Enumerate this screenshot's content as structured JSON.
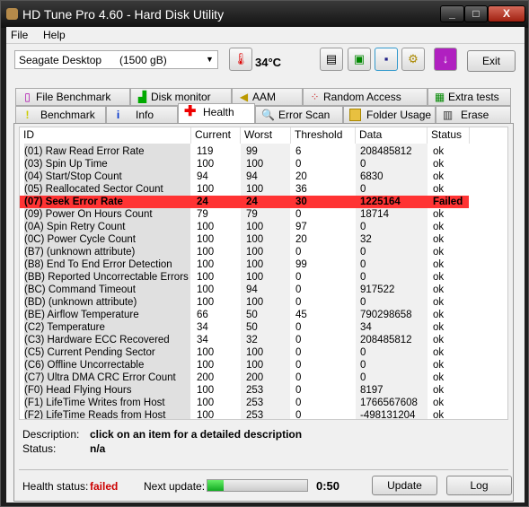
{
  "window": {
    "title": "HD Tune Pro 4.60 - Hard Disk Utility",
    "minimize": "_",
    "maximize": "□",
    "close": "X"
  },
  "menu": [
    "File",
    "Help"
  ],
  "toolbar": {
    "drive_name": "Seagate Desktop",
    "drive_size": "(1500 gB)",
    "temperature": "34°C",
    "exit_label": "Exit",
    "icons": [
      "copy-text-icon",
      "copy-screenshot-icon",
      "save-icon",
      "options-icon",
      "download-icon"
    ]
  },
  "tabs_top": [
    {
      "label": "File Benchmark",
      "icon": "file-benchmark-icon"
    },
    {
      "label": "Disk monitor",
      "icon": "disk-monitor-icon"
    },
    {
      "label": "AAM",
      "icon": "speaker-icon"
    },
    {
      "label": "Random Access",
      "icon": "random-access-icon"
    },
    {
      "label": "Extra tests",
      "icon": "extra-tests-icon"
    }
  ],
  "tabs_bottom": [
    {
      "label": "Benchmark",
      "icon": "exclamation-icon"
    },
    {
      "label": "Info",
      "icon": "info-icon"
    },
    {
      "label": "Health",
      "icon": "red-cross-icon",
      "active": true
    },
    {
      "label": "Error Scan",
      "icon": "magnifier-icon"
    },
    {
      "label": "Folder Usage",
      "icon": "folder-icon"
    },
    {
      "label": "Erase",
      "icon": "trash-icon"
    }
  ],
  "table": {
    "columns": [
      "ID",
      "Current",
      "Worst",
      "Threshold",
      "Data",
      "Status"
    ],
    "rows": [
      [
        "(01) Raw Read Error Rate",
        "119",
        "99",
        "6",
        "208485812",
        "ok"
      ],
      [
        "(03) Spin Up Time",
        "100",
        "100",
        "0",
        "0",
        "ok"
      ],
      [
        "(04) Start/Stop Count",
        "94",
        "94",
        "20",
        "6830",
        "ok"
      ],
      [
        "(05) Reallocated Sector Count",
        "100",
        "100",
        "36",
        "0",
        "ok"
      ],
      [
        "(07) Seek Error Rate",
        "24",
        "24",
        "30",
        "1225164",
        "Failed"
      ],
      [
        "(09) Power On Hours Count",
        "79",
        "79",
        "0",
        "18714",
        "ok"
      ],
      [
        "(0A) Spin Retry Count",
        "100",
        "100",
        "97",
        "0",
        "ok"
      ],
      [
        "(0C) Power Cycle Count",
        "100",
        "100",
        "20",
        "32",
        "ok"
      ],
      [
        "(B7) (unknown attribute)",
        "100",
        "100",
        "0",
        "0",
        "ok"
      ],
      [
        "(B8) End To End Error Detection",
        "100",
        "100",
        "99",
        "0",
        "ok"
      ],
      [
        "(BB) Reported Uncorrectable Errors",
        "100",
        "100",
        "0",
        "0",
        "ok"
      ],
      [
        "(BC) Command Timeout",
        "100",
        "94",
        "0",
        "917522",
        "ok"
      ],
      [
        "(BD) (unknown attribute)",
        "100",
        "100",
        "0",
        "0",
        "ok"
      ],
      [
        "(BE) Airflow Temperature",
        "66",
        "50",
        "45",
        "790298658",
        "ok"
      ],
      [
        "(C2) Temperature",
        "34",
        "50",
        "0",
        "34",
        "ok"
      ],
      [
        "(C3) Hardware ECC Recovered",
        "34",
        "32",
        "0",
        "208485812",
        "ok"
      ],
      [
        "(C5) Current Pending Sector",
        "100",
        "100",
        "0",
        "0",
        "ok"
      ],
      [
        "(C6) Offline Uncorrectable",
        "100",
        "100",
        "0",
        "0",
        "ok"
      ],
      [
        "(C7) Ultra DMA CRC Error Count",
        "200",
        "200",
        "0",
        "0",
        "ok"
      ],
      [
        "(F0) Head Flying Hours",
        "100",
        "253",
        "0",
        "8197",
        "ok"
      ],
      [
        "(F1) LifeTime Writes from Host",
        "100",
        "253",
        "0",
        "1766567608",
        "ok"
      ],
      [
        "(F2) LifeTime Reads from Host",
        "100",
        "253",
        "0",
        "-498131204",
        "ok"
      ]
    ]
  },
  "details": {
    "description_label": "Description:",
    "description": "click on an item for a detailed description",
    "status_label": "Status:",
    "status": "n/a"
  },
  "footer": {
    "health_label": "Health status:",
    "health": "failed",
    "next_update_label": "Next update:",
    "next_update_progress": 0.16,
    "countdown": "0:50",
    "update_label": "Update",
    "log_label": "Log"
  },
  "colors": {
    "failed_row": "#ff3333",
    "failed_text": "#cc0000",
    "progress": "#22c040"
  }
}
